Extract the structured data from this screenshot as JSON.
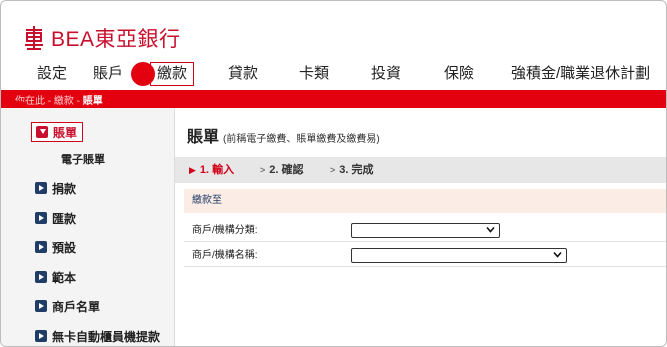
{
  "brand": {
    "name": "BEA東亞銀行",
    "logo_icon": "bea-logo-icon",
    "color": "#c8102e"
  },
  "topnav": {
    "items": [
      {
        "label": "設定"
      },
      {
        "label": "賬戶"
      },
      {
        "label": "繳款",
        "active": true
      },
      {
        "label": "貸款"
      },
      {
        "label": "卡類"
      },
      {
        "label": "投資"
      },
      {
        "label": "保險"
      },
      {
        "label": "強積金/職業退休計劃"
      }
    ]
  },
  "breadcrumb": {
    "prefix": "你在此 - 繳款 - ",
    "current": "賬單"
  },
  "sidebar": {
    "items": [
      {
        "label": "賬單",
        "active": true
      },
      {
        "label": "電子賬單",
        "sub": true
      },
      {
        "label": "捐款"
      },
      {
        "label": "匯款"
      },
      {
        "label": "預設"
      },
      {
        "label": "範本"
      },
      {
        "label": "商戶名單"
      },
      {
        "label": "無卡自動櫃員機提款"
      }
    ]
  },
  "main": {
    "title": "賬單",
    "subtitle": "(前稱電子繳費、賬單繳費及繳費易)",
    "steps": [
      {
        "label": "1. 輸入",
        "active": true
      },
      {
        "label": "2. 確認"
      },
      {
        "label": "3. 完成"
      }
    ],
    "section_label": "繳款至",
    "fields": [
      {
        "label": "商戶/機構分類:",
        "value": ""
      },
      {
        "label": "商戶/機構名稱:",
        "value": ""
      }
    ]
  },
  "colors": {
    "accent": "#e3000f",
    "nav_icon": "#1f3d66",
    "section_bg": "#fbece6"
  }
}
